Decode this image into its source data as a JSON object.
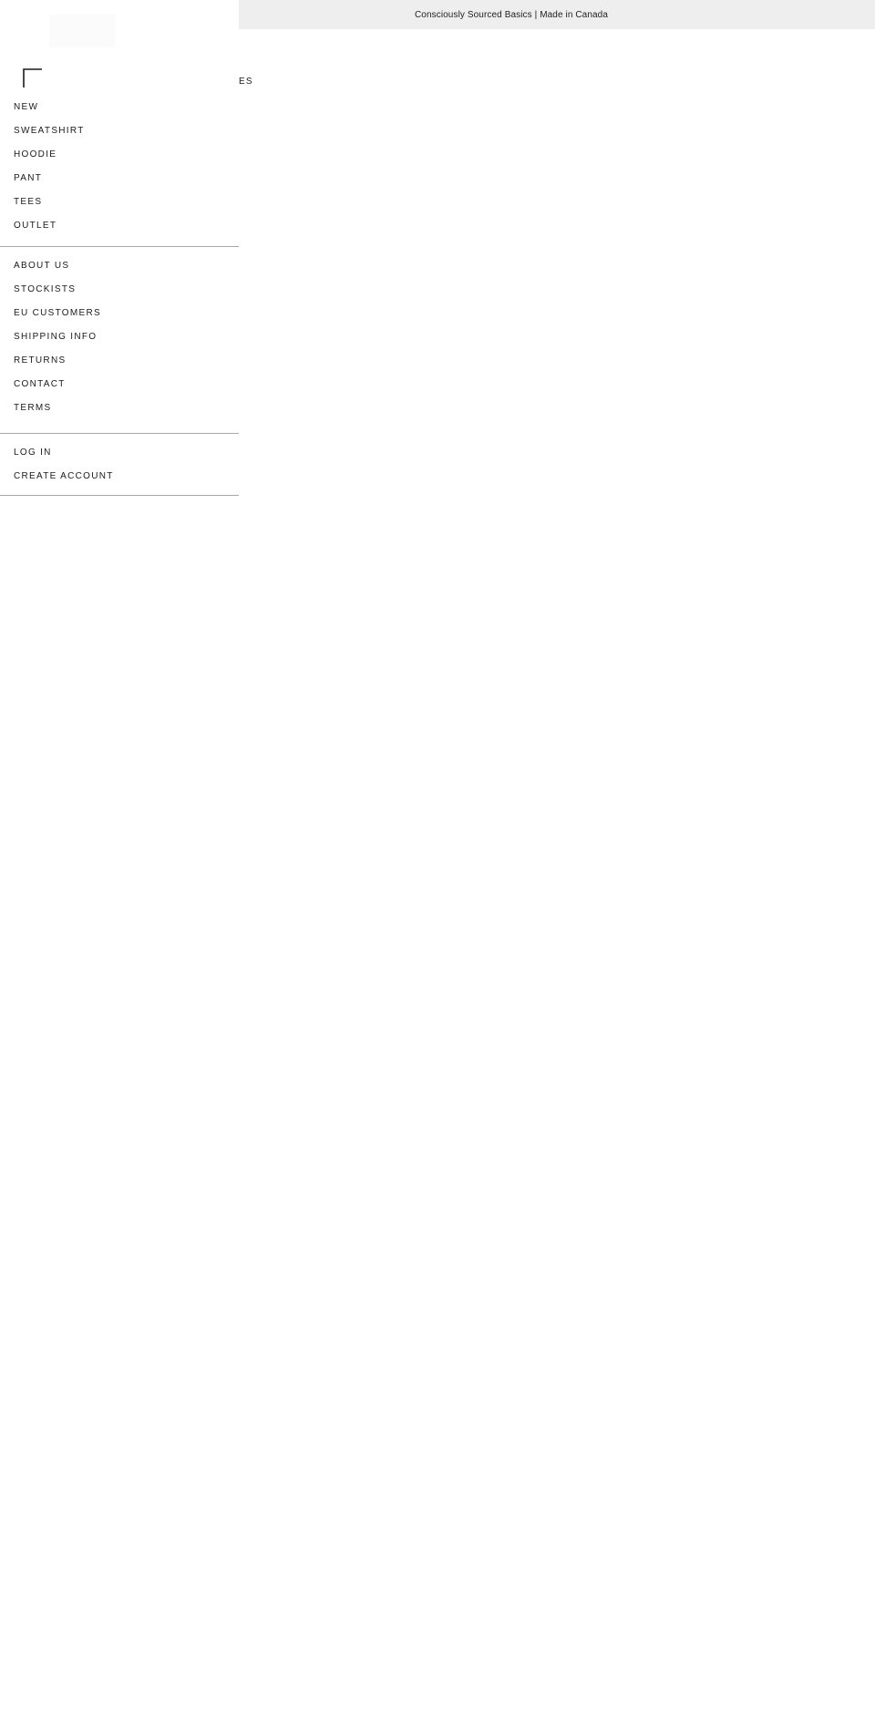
{
  "announcement": {
    "text": "Consciously Sourced Basics | Made in Canada"
  },
  "background_nav": {
    "fragment": "ES"
  },
  "drawer": {
    "close_icon": "close-icon",
    "primary_items": [
      {
        "label": "NEW"
      },
      {
        "label": "SWEATSHIRT"
      },
      {
        "label": "HOODIE"
      },
      {
        "label": "PANT"
      },
      {
        "label": "TEES"
      },
      {
        "label": "OUTLET"
      }
    ],
    "secondary_items": [
      {
        "label": "ABOUT US"
      },
      {
        "label": "STOCKISTS"
      },
      {
        "label": "EU CUSTOMERS"
      },
      {
        "label": "SHIPPING INFO"
      },
      {
        "label": "RETURNS"
      },
      {
        "label": "CONTACT"
      },
      {
        "label": "TERMS"
      }
    ],
    "account_items": [
      {
        "label": "LOG IN"
      },
      {
        "label": "CREATE ACCOUNT"
      }
    ]
  },
  "colors": {
    "announcement_bg": "#eeeeee",
    "text": "#1a1a1a",
    "divider": "#a8a8a8",
    "background": "#ffffff"
  }
}
